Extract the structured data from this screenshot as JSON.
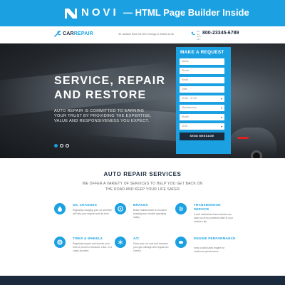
{
  "banner": {
    "brand": "NOVI",
    "tagline": "— HTML Page Builder Inside"
  },
  "header": {
    "logo_prefix": "CAR",
    "logo_suffix": "REPAIR",
    "address": "35 Jackson Blvd Ste 300 Chicago IL 60604-2145",
    "phone_caption": "We are open 24/7",
    "phone": "800-23345-6789"
  },
  "hero": {
    "title": "SERVICE, REPAIR AND RESTORE",
    "text": "AUTO REPAIR IS COMMITTED TO EARNING YOUR TRUST BY PROVIDING THE EXPERTISE, VALUE AND RESPONSIVENESS YOU EXPECT.",
    "slides_total": 3,
    "active_slide": 1
  },
  "request_form": {
    "title": "MAKE A REQUEST",
    "fields": [
      {
        "placeholder": "Name"
      },
      {
        "placeholder": "Phone"
      },
      {
        "placeholder": "Email"
      },
      {
        "placeholder": "Date"
      }
    ],
    "time_select": "10:00 - 11:00",
    "manufacturer": "Manufacturer",
    "model": "Model",
    "year": "2016",
    "submit_label": "SEND MESSAGE"
  },
  "services": {
    "title": "AUTO REPAIR SERVICES",
    "subtitle": "WE OFFER A VARIETY OF SERVICES TO HELP YOU GET BACK ON THE ROAD AND KEEP YOUR LIFE SAFER",
    "items": [
      {
        "name": "OIL CHANGES",
        "icon": "oil-icon",
        "desc": "Regularly changing your oil and filter will help your engine work its best."
      },
      {
        "name": "BRAKES",
        "icon": "brake-icon",
        "desc": "Brake maintenance is crucial to keeping your vehicle operating safely."
      },
      {
        "name": "TRANSMISSION SERVICE",
        "icon": "gear-icon",
        "desc": "A well maintained transmission can save you from problems later in your vehicle's life."
      },
      {
        "name": "TIRES & WHEELS",
        "icon": "tire-icon",
        "desc": "Regularly inspect and service your tires to prevent a blowout, a flat, or a costly accident."
      },
      {
        "name": "A/C",
        "icon": "snowflake-icon",
        "desc": "Keep your car cool and increase your gas mileage with regular AC checks."
      },
      {
        "name": "ENGINE PERFORMANCE",
        "icon": "engine-icon",
        "desc": "Keep a well-tuned engine for maximum performance."
      }
    ]
  },
  "colors": {
    "accent": "#1ba1e2",
    "dark": "#1b2a3d"
  }
}
